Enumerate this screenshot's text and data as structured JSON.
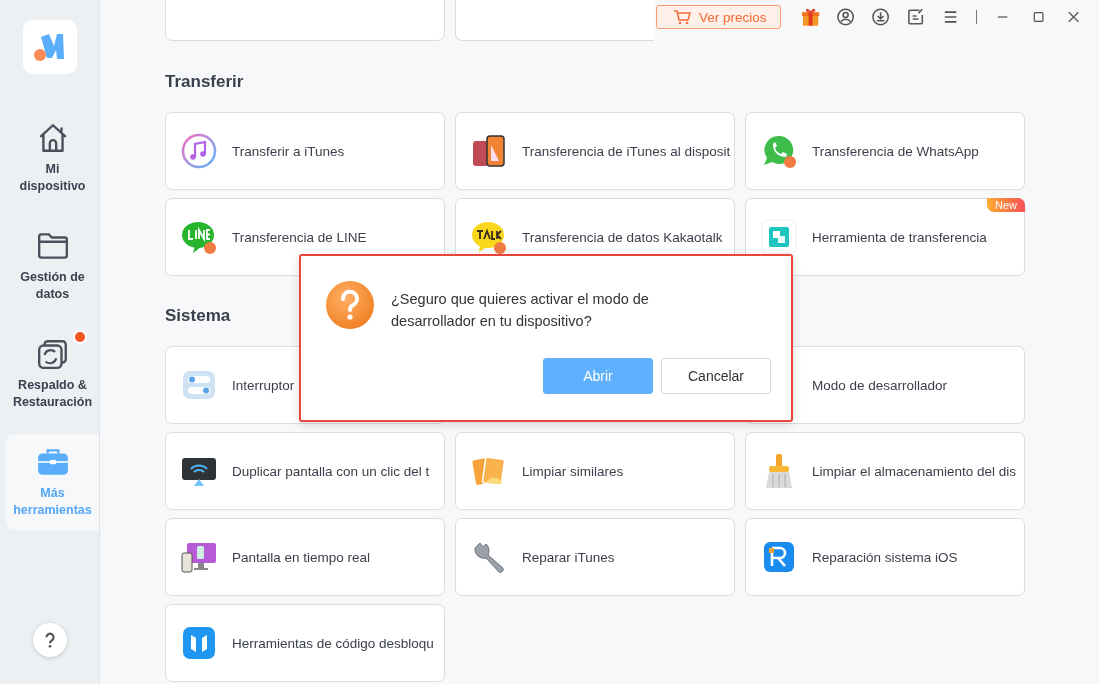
{
  "sidebar": {
    "items": [
      {
        "label": "Mi dispositivo",
        "kind": "home",
        "selected": false,
        "notification": false
      },
      {
        "label": "Gestión de datos",
        "kind": "folder",
        "selected": false,
        "notification": false
      },
      {
        "label": "Respaldo & Restauración",
        "kind": "backup",
        "selected": false,
        "notification": true
      },
      {
        "label": "Más herramientas",
        "kind": "toolbox",
        "selected": true,
        "notification": false
      }
    ]
  },
  "topbar": {
    "pricing_button": "Ver precios"
  },
  "sections": [
    {
      "title": "Transferir",
      "items": [
        {
          "label": "Transferir a iTunes",
          "kind": "music"
        },
        {
          "label": "Transferencia de iTunes al disposit",
          "kind": "phones"
        },
        {
          "label": "Transferencia de WhatsApp",
          "kind": "whatsapp"
        },
        {
          "label": "Transferencia de LINE",
          "kind": "line"
        },
        {
          "label": "Transferencia de datos Kakaotalk",
          "kind": "talk"
        },
        {
          "label": "Herramienta de transferencia",
          "kind": "transfer",
          "badge": "New"
        }
      ]
    },
    {
      "title": "Sistema",
      "items": [
        {
          "label": "Interruptor",
          "kind": "toggle"
        },
        {
          "label": "Modo de desarrollador",
          "kind": "covered"
        },
        {
          "label": "Duplicar pantalla con un clic del t",
          "kind": "mirror"
        },
        {
          "label": "Limpiar similares",
          "kind": "photos"
        },
        {
          "label": "Limpiar el almacenamiento del dis",
          "kind": "broom"
        },
        {
          "label": "Pantalla en tiempo real",
          "kind": "realtime"
        },
        {
          "label": "Reparar iTunes",
          "kind": "wrench"
        },
        {
          "label": "Reparación sistema iOS",
          "kind": "repair"
        },
        {
          "label": "Herramientas de código desbloqu",
          "kind": "unlock"
        }
      ]
    }
  ],
  "dialog": {
    "message": "¿Seguro que quieres activar el modo de desarrollador en tu dispositivo?",
    "buttons": [
      {
        "label": "Abrir",
        "kind": "primary"
      },
      {
        "label": "Cancelar",
        "kind": "secondary"
      }
    ]
  }
}
